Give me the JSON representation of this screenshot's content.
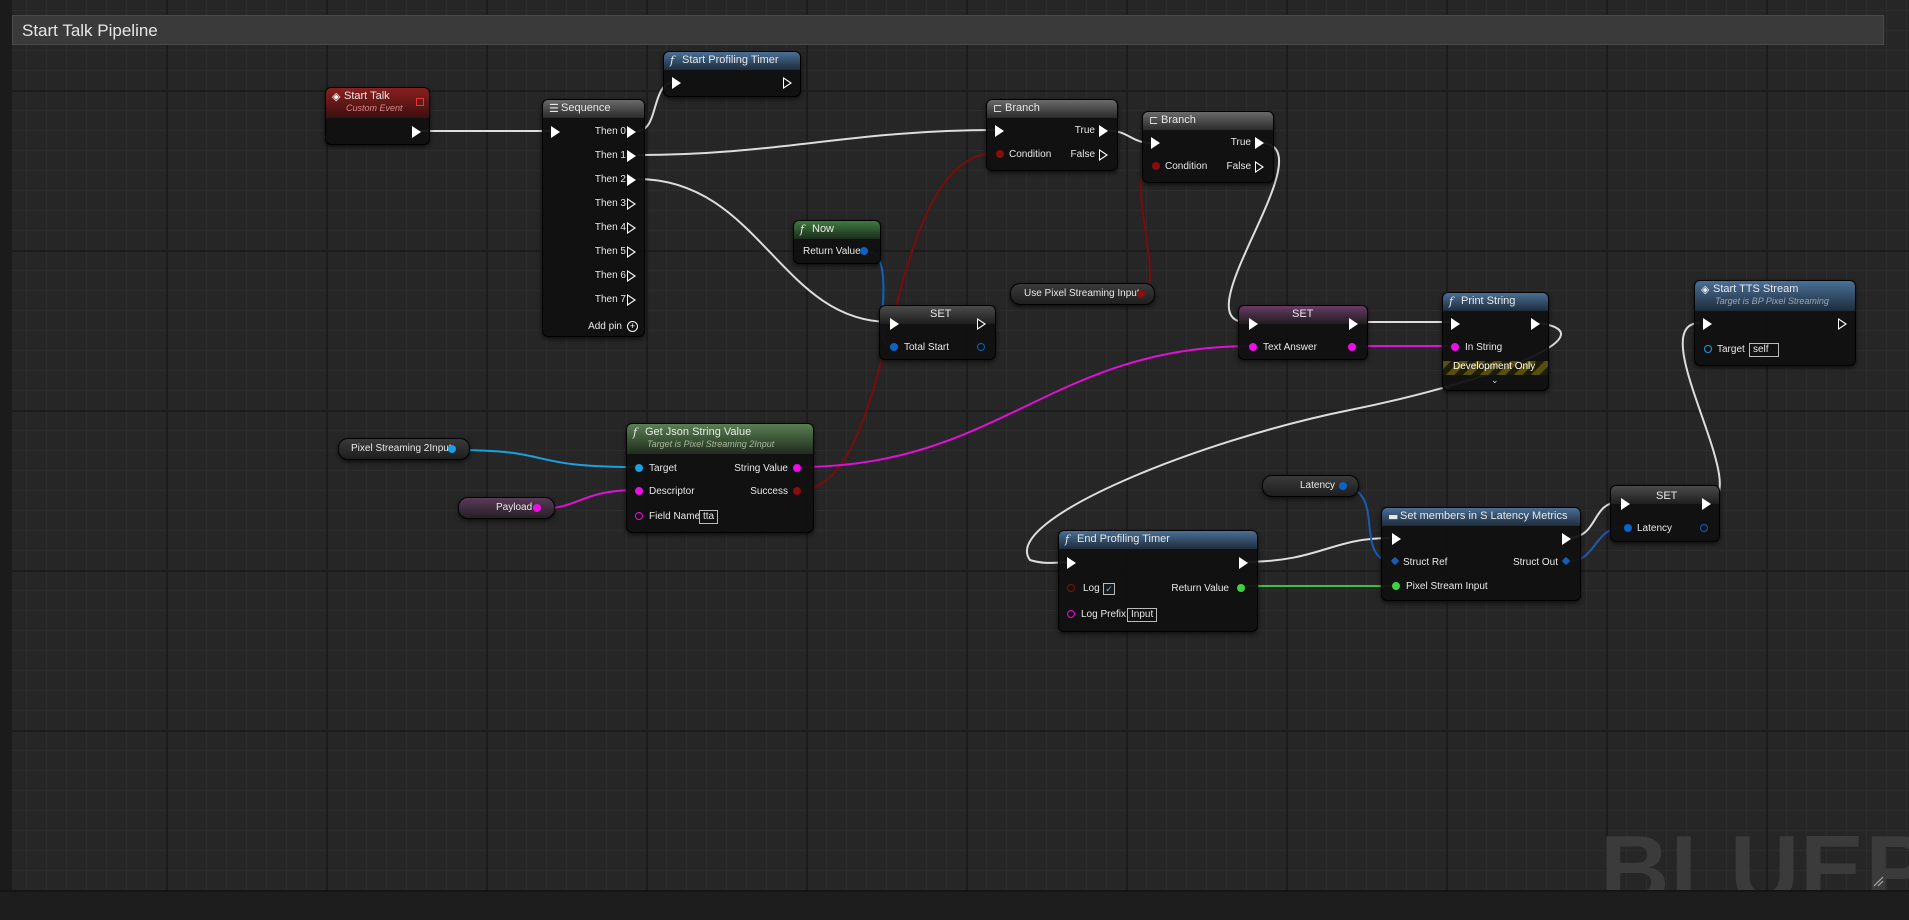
{
  "graph_title": "Start Talk Pipeline",
  "watermark": "BLUEPR",
  "colors": {
    "exec": "#ffffff",
    "bool": "#8b0c0c",
    "string": "#f00ce7",
    "object": "#00a9f4",
    "float": "#0b63c7",
    "struct": "#1a5bb5",
    "green": "#3fd13f"
  },
  "nodes": {
    "start_talk": {
      "title": "Start Talk",
      "subtitle": "Custom Event"
    },
    "sequence": {
      "title": "Sequence",
      "outputs": [
        "Then 0",
        "Then 1",
        "Then 2",
        "Then 3",
        "Then 4",
        "Then 5",
        "Then 6",
        "Then 7"
      ],
      "add_pin": "Add pin"
    },
    "start_profiling": {
      "title": "Start Profiling Timer"
    },
    "branch1": {
      "title": "Branch",
      "condition": "Condition",
      "true": "True",
      "false": "False"
    },
    "branch2": {
      "title": "Branch",
      "condition": "Condition",
      "true": "True",
      "false": "False"
    },
    "now": {
      "title": "Now",
      "return": "Return Value"
    },
    "set_total": {
      "title": "SET",
      "var": "Total Start"
    },
    "use_pixel": {
      "label": "Use Pixel Streaming Input"
    },
    "set_text": {
      "title": "SET",
      "var": "Text Answer"
    },
    "print_string": {
      "title": "Print String",
      "in_string": "In String",
      "dev_only": "Development Only"
    },
    "start_tts": {
      "title": "Start TTS Stream",
      "subtitle": "Target is BP Pixel Streaming",
      "target": "Target",
      "target_value": "self"
    },
    "pixel_input_var": {
      "label": "Pixel Streaming 2Input"
    },
    "payload_var": {
      "label": "Payload"
    },
    "get_json": {
      "title": "Get Json String Value",
      "subtitle": "Target is Pixel Streaming 2Input",
      "target": "Target",
      "descriptor": "Descriptor",
      "field_name": "Field Name",
      "field_value": "tta",
      "string_value": "String Value",
      "success": "Success"
    },
    "latency_var": {
      "label": "Latency"
    },
    "set_members": {
      "title": "Set members in S Latency Metrics",
      "struct_ref": "Struct Ref",
      "struct_out": "Struct Out",
      "pixel_stream_input": "Pixel Stream Input"
    },
    "set_latency": {
      "title": "SET",
      "var": "Latency"
    },
    "end_profiling": {
      "title": "End Profiling Timer",
      "log": "Log",
      "log_checked": "✓",
      "log_prefix": "Log Prefix",
      "log_prefix_value": "Input",
      "return": "Return Value"
    }
  }
}
